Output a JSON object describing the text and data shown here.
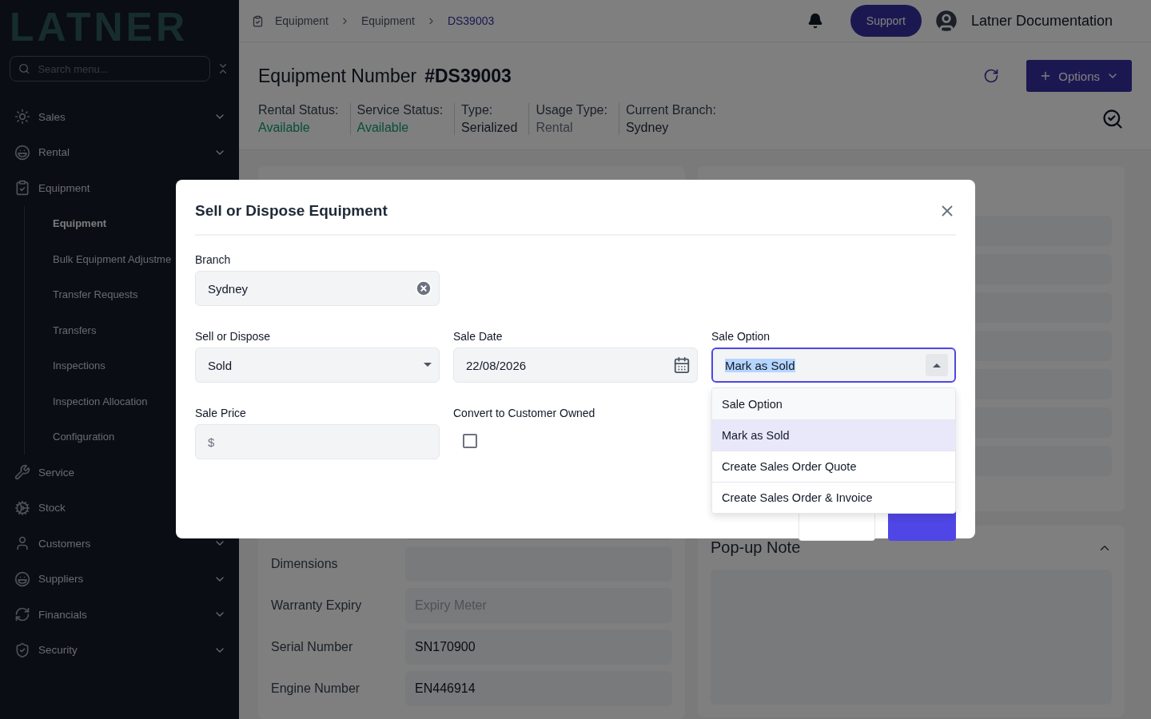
{
  "sidebar": {
    "logo": "LATNER",
    "search": {
      "placeholder": "Search menu..."
    },
    "items": [
      {
        "label": "Sales",
        "expandable": true,
        "expanded": false
      },
      {
        "label": "Rental",
        "expandable": true,
        "expanded": false
      },
      {
        "label": "Equipment",
        "expanded": true,
        "children": [
          {
            "label": "Equipment",
            "selected": true
          },
          {
            "label": "Bulk Equipment Adjustme",
            "selected": false
          },
          {
            "label": "Transfer Requests",
            "selected": false
          },
          {
            "label": "Transfers",
            "selected": false
          },
          {
            "label": "Inspections",
            "selected": false
          },
          {
            "label": "Inspection Allocation",
            "selected": false
          },
          {
            "label": "Configuration",
            "selected": false
          }
        ]
      },
      {
        "label": "Service",
        "expanded": false
      },
      {
        "label": "Stock",
        "expanded": false
      },
      {
        "label": "Customers",
        "expandable": true,
        "expanded": false
      },
      {
        "label": "Suppliers",
        "expandable": true,
        "expanded": false
      },
      {
        "label": "Financials",
        "expandable": true,
        "expanded": false
      },
      {
        "label": "Security",
        "expandable": true,
        "expanded": false
      }
    ]
  },
  "header": {
    "breadcrumbs": [
      "Equipment",
      "Equipment",
      "DS39003"
    ],
    "support": "Support",
    "user": "Latner Documentation"
  },
  "title": {
    "label": "Equipment Number",
    "number": "#DS39003",
    "options": "Options"
  },
  "statuses": [
    {
      "label": "Rental Status:",
      "value": "Available",
      "kind": "success"
    },
    {
      "label": "Service Status:",
      "value": "Available",
      "kind": "success"
    },
    {
      "label": "Type:",
      "value": "Serialized",
      "kind": "strong"
    },
    {
      "label": "Usage Type:",
      "value": "Rental",
      "kind": "muted"
    },
    {
      "label": "Current Branch:",
      "value": "Sydney",
      "kind": "strong"
    }
  ],
  "details": {
    "rows": [
      {
        "label": "Dimensions"
      },
      {
        "label": "Warranty Expiry",
        "placeholder": "Expiry Meter"
      },
      {
        "label": "Serial Number",
        "value": "SN170900"
      },
      {
        "label": "Engine Number",
        "value": "EN446914"
      }
    ]
  },
  "note_card": {
    "title": "Pop-up Note"
  },
  "dialog": {
    "title": "Sell or Dispose Equipment",
    "branch": {
      "label": "Branch",
      "value": "Sydney"
    },
    "sell_or_dispose": {
      "label": "Sell or Dispose",
      "value": "Sold"
    },
    "sale_date": {
      "label": "Sale Date",
      "value": "22/08/2026"
    },
    "sale_option": {
      "label": "Sale Option",
      "value": "Mark as Sold",
      "options": [
        {
          "label": "Sale Option",
          "kind": "placeholder",
          "selected": false
        },
        {
          "label": "Mark as Sold",
          "kind": "option",
          "selected": true
        },
        {
          "label": "Create Sales Order Quote",
          "kind": "option",
          "selected": false
        },
        {
          "label": "Create Sales Order & Invoice",
          "kind": "option",
          "selected": false
        }
      ]
    },
    "sale_price": {
      "label": "Sale Price",
      "prefix": "$"
    },
    "convert": {
      "label": "Convert to Customer Owned",
      "checked": false
    }
  }
}
